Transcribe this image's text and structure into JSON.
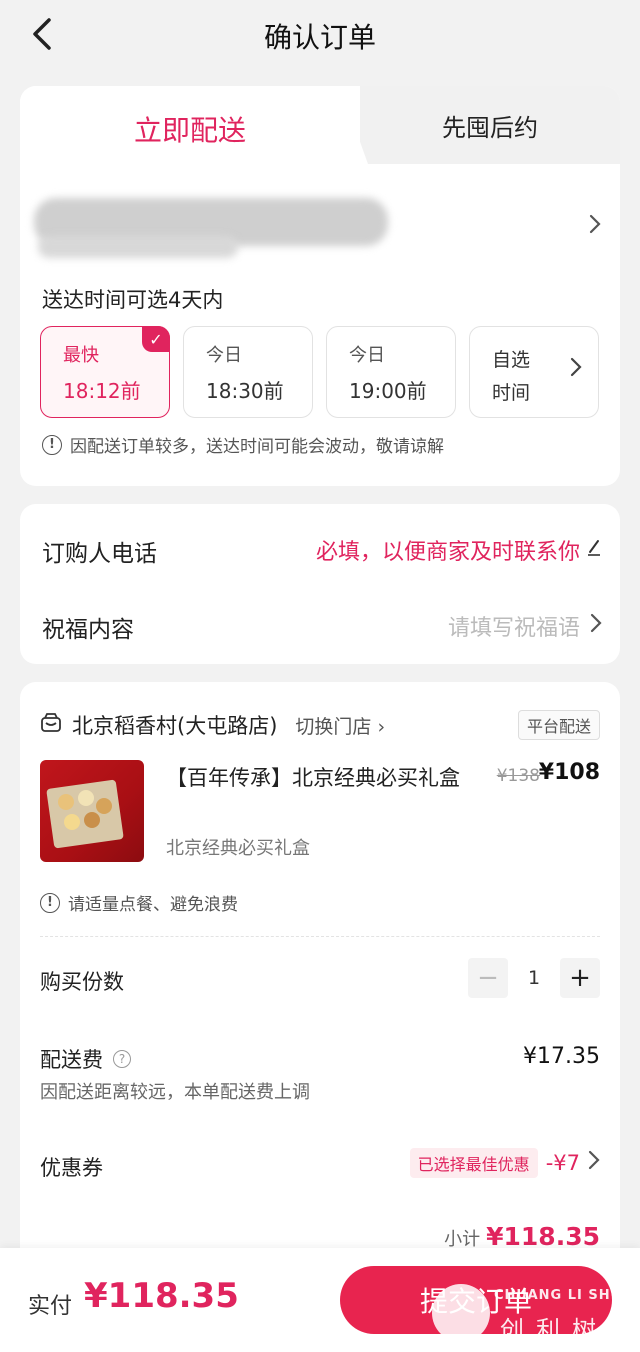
{
  "header": {
    "title": "确认订单",
    "back_icon": "back-chevron-icon"
  },
  "delivery_tabs": {
    "active": "立即配送",
    "inactive": "先囤后约"
  },
  "delivery": {
    "hint": "送达时间可选4天内",
    "slots": [
      {
        "line1": "最快",
        "line2": "18:12前",
        "selected": true
      },
      {
        "line1": "今日",
        "line2": "18:30前",
        "selected": false
      },
      {
        "line1": "今日",
        "line2": "19:00前",
        "selected": false
      }
    ],
    "custom_slot": {
      "line1": "自选",
      "line2": "时间"
    },
    "warning": "因配送订单较多，送达时间可能会波动，敬请谅解"
  },
  "contact": {
    "phone_label": "订购人电话",
    "phone_placeholder": "必填，以便商家及时联系你",
    "blessing_label": "祝福内容",
    "blessing_placeholder": "请填写祝福语"
  },
  "order": {
    "store_name": "北京稻香村(大屯路店)",
    "switch_store": "切换门店",
    "delivery_badge": "平台配送",
    "product": {
      "title": "【百年传承】北京经典必买礼盒",
      "subtitle": "北京经典必买礼盒",
      "price_old": "¥138",
      "price_new": "¥108"
    },
    "tip": "请适量点餐、避免浪费",
    "quantity_label": "购买份数",
    "quantity": "1",
    "fee_label": "配送费",
    "fee_value": "¥17.35",
    "fee_note": "因配送距离较远，本单配送费上调",
    "coupon_label": "优惠券",
    "coupon_tag": "已选择最佳优惠",
    "coupon_value": "-¥7",
    "subtotal_label": "小计",
    "subtotal_value": "¥118.35"
  },
  "bottom": {
    "pay_label": "实付",
    "pay_amount": "¥118.35",
    "submit_label": "提交订单"
  },
  "watermark": {
    "line1": "CHUANG LI SHU",
    "line2": "创利树"
  },
  "colors": {
    "accent": "#e0245e",
    "button": "#e8244f"
  }
}
